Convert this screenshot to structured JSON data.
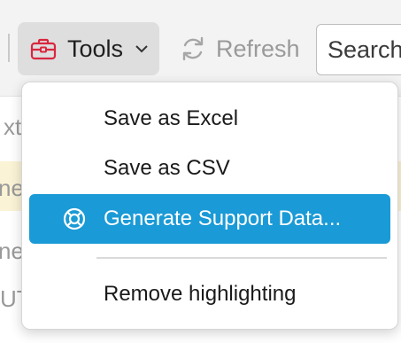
{
  "toolbar": {
    "tools_label": "Tools",
    "refresh_label": "Refresh",
    "search_placeholder": "Search"
  },
  "background": {
    "fragments": [
      "xt",
      "ne",
      "ne",
      "UT | Contro"
    ]
  },
  "menu": {
    "items": [
      {
        "label": "Save as Excel"
      },
      {
        "label": "Save as CSV"
      },
      {
        "label": "Generate Support Data..."
      },
      {
        "label": "Remove highlighting"
      }
    ]
  },
  "colors": {
    "accent": "#1a9ad6",
    "tools_icon": "#d9263f",
    "highlight_row": "#fbf3d5"
  }
}
